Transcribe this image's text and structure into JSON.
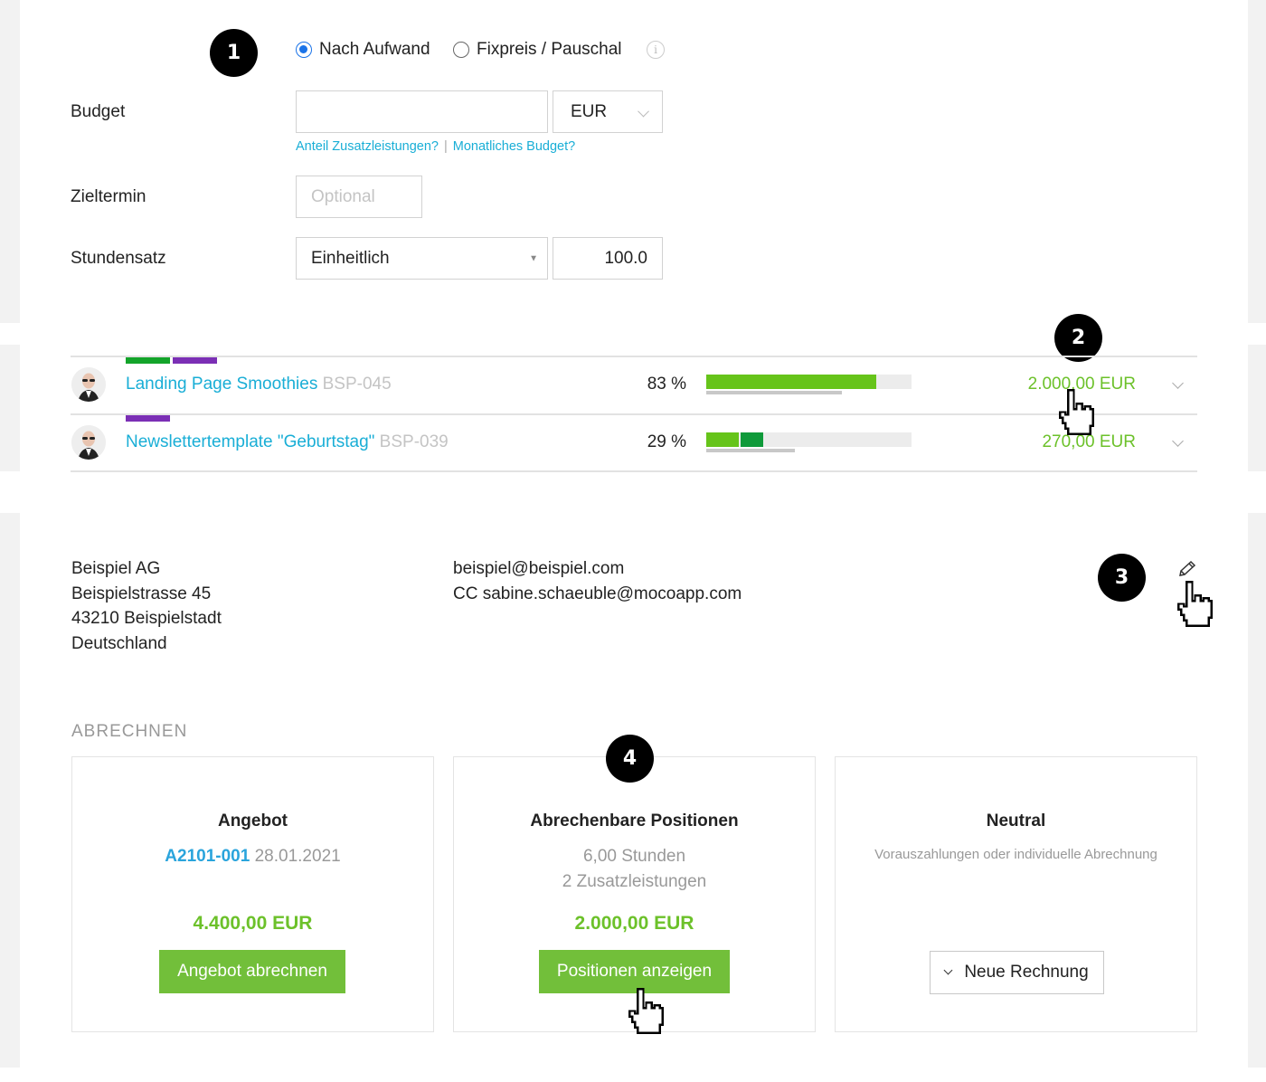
{
  "callouts": [
    "1",
    "2",
    "3",
    "4"
  ],
  "form": {
    "billing_type": {
      "options": [
        {
          "label": "Nach Aufwand",
          "checked": true
        },
        {
          "label": "Fixpreis / Pauschal",
          "checked": false
        }
      ],
      "info_icon": "info-icon"
    },
    "budget": {
      "label": "Budget",
      "value": "",
      "currency": "EUR",
      "links": [
        "Anteil Zusatzleistungen?",
        "Monatliches Budget?"
      ],
      "link_separator": "|"
    },
    "deadline": {
      "label": "Zieltermin",
      "placeholder": "Optional"
    },
    "hourly_rate": {
      "label": "Stundensatz",
      "mode": "Einheitlich",
      "value": "100.0"
    }
  },
  "projects": [
    {
      "name": "Landing Page Smoothies",
      "code": "BSP-045",
      "tags": [
        "#13a42a",
        "#7b2fb5"
      ],
      "percent_label": "83 %",
      "progress": [
        {
          "fraction": 0.83,
          "color": "#66c41a"
        }
      ],
      "secondary_fraction": 0.66,
      "amount": "2.000,00 EUR"
    },
    {
      "name": "Newslettertemplate \"Geburtstag\"",
      "code": "BSP-039",
      "tags": [
        "#7b2fb5"
      ],
      "percent_label": "29 %",
      "progress": [
        {
          "fraction": 0.16,
          "color": "#66c41a"
        },
        {
          "fraction": 0.12,
          "color": "#0f9a3a"
        }
      ],
      "secondary_fraction": 0.43,
      "amount": "270,00 EUR"
    }
  ],
  "customer": {
    "address": [
      "Beispiel AG",
      "Beispielstrasse 45",
      "43210 Beispielstadt",
      "Deutschland"
    ],
    "emails": [
      "beispiel@beispiel.com",
      "CC sabine.schaeuble@mocoapp.com"
    ]
  },
  "billing": {
    "section_title": "ABRECHNEN",
    "cards": [
      {
        "title": "Angebot",
        "ref": "A2101-001",
        "date": "28.01.2021",
        "amount": "4.400,00 EUR",
        "button": "Angebot abrechnen"
      },
      {
        "title": "Abrechenbare Positionen",
        "lines": [
          "6,00 Stunden",
          "2 Zusatzleistungen"
        ],
        "amount": "2.000,00 EUR",
        "button": "Positionen anzeigen"
      },
      {
        "title": "Neutral",
        "description": "Vorauszahlungen oder individuelle Abrechnung",
        "button": "Neue Rechnung"
      }
    ]
  },
  "colors": {
    "link": "#19aed6",
    "green": "#6cc12a",
    "button_green": "#72bf3a",
    "radio_blue": "#1a73e8"
  }
}
